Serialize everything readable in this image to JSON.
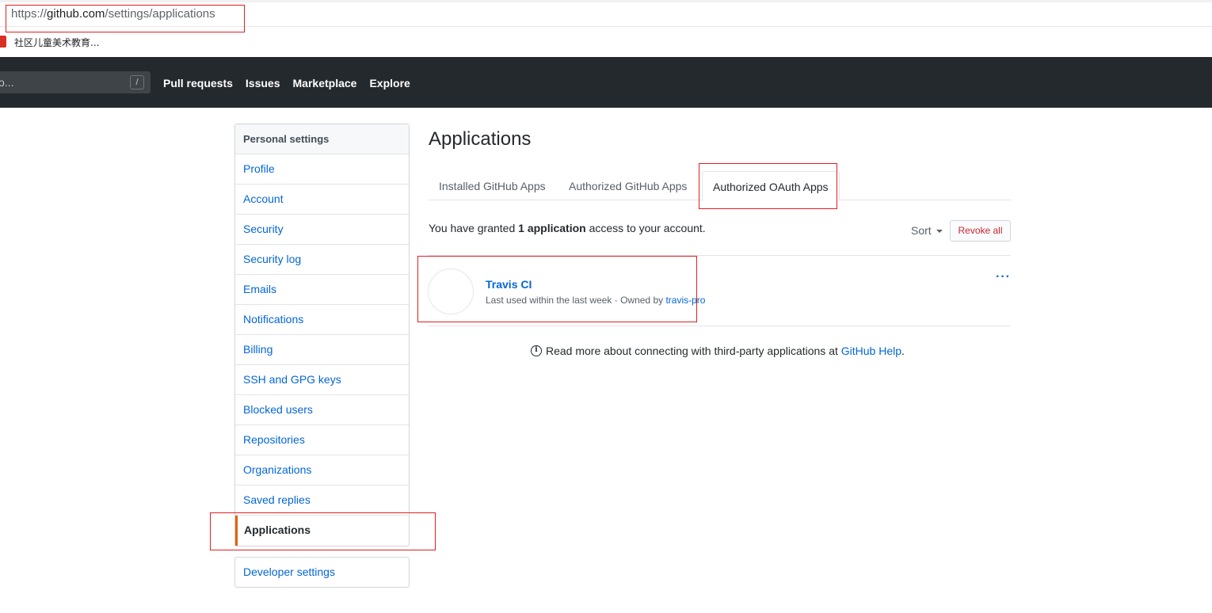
{
  "browser": {
    "url_scheme": "https://",
    "url_host": "github.com",
    "url_path": "/settings/applications",
    "bookmark_label": "社区儿童美术教育..."
  },
  "header": {
    "search_placeholder": "o...",
    "search_shortcut": "/",
    "nav": [
      "Pull requests",
      "Issues",
      "Marketplace",
      "Explore"
    ]
  },
  "sidebar": {
    "heading": "Personal settings",
    "items": [
      "Profile",
      "Account",
      "Security",
      "Security log",
      "Emails",
      "Notifications",
      "Billing",
      "SSH and GPG keys",
      "Blocked users",
      "Repositories",
      "Organizations",
      "Saved replies",
      "Applications"
    ],
    "selected": "Applications",
    "developer_settings": "Developer settings"
  },
  "main": {
    "title": "Applications",
    "tabs": [
      "Installed GitHub Apps",
      "Authorized GitHub Apps",
      "Authorized OAuth Apps"
    ],
    "active_tab": "Authorized OAuth Apps",
    "granted_prefix": "You have granted ",
    "granted_count": "1 application",
    "granted_suffix": " access to your account.",
    "sort_label": "Sort",
    "revoke_all": "Revoke all",
    "app": {
      "name": "Travis CI",
      "meta_prefix": "Last used within the last week · Owned by ",
      "owner": "travis-pro",
      "menu": "···"
    },
    "help_text": "Read more about connecting with third-party applications at ",
    "help_link": "GitHub Help",
    "help_end": "."
  },
  "colors": {
    "header_bg": "#24292e",
    "link": "#0366d6",
    "selected_accent": "#e36209",
    "danger": "#cb2431",
    "annotation": "#e02020"
  }
}
